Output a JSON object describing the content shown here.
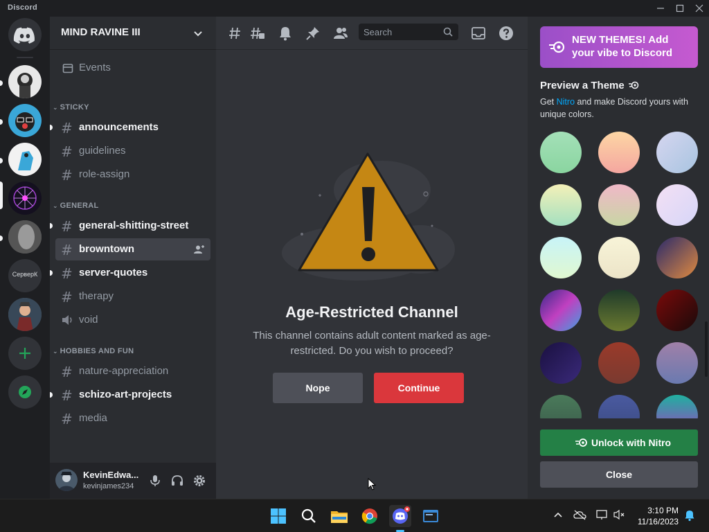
{
  "window": {
    "title": "Discord"
  },
  "guild": {
    "name": "MIND RAVINE III"
  },
  "sidebar": {
    "events_label": "Events",
    "categories": [
      {
        "name": "STICKY",
        "channels": [
          {
            "label": "announcements",
            "unread": true,
            "kind": "announcement"
          },
          {
            "label": "guidelines",
            "unread": false,
            "kind": "text"
          },
          {
            "label": "role-assign",
            "unread": false,
            "kind": "text"
          }
        ]
      },
      {
        "name": "GENERAL",
        "channels": [
          {
            "label": "general-shitting-street",
            "unread": true,
            "kind": "text"
          },
          {
            "label": "browntown",
            "active": true,
            "kind": "text"
          },
          {
            "label": "server-quotes",
            "unread": true,
            "kind": "text"
          },
          {
            "label": "therapy",
            "unread": false,
            "kind": "text"
          },
          {
            "label": "void",
            "unread": false,
            "kind": "voice"
          }
        ]
      },
      {
        "name": "HOBBIES AND FUN",
        "channels": [
          {
            "label": "nature-appreciation",
            "unread": false,
            "kind": "text"
          },
          {
            "label": "schizo-art-projects",
            "unread": true,
            "kind": "text"
          },
          {
            "label": "media",
            "unread": false,
            "kind": "text"
          }
        ]
      }
    ]
  },
  "servers": {
    "text_server_label": "СерверК"
  },
  "user": {
    "display_name": "KevinEdwa...",
    "username": "kevinjames234"
  },
  "toolbar": {
    "search_placeholder": "Search"
  },
  "age_gate": {
    "title": "Age-Restricted Channel",
    "description": "This channel contains adult content marked as age-restricted. Do you wish to proceed?",
    "nope_label": "Nope",
    "continue_label": "Continue"
  },
  "theme_panel": {
    "promo_text": "NEW THEMES! Add your vibe to Discord",
    "title": "Preview a Theme",
    "desc_prefix": "Get ",
    "desc_link": "Nitro",
    "desc_suffix": " and make Discord yours with unique colors.",
    "unlock_label": "Unlock with Nitro",
    "close_label": "Close",
    "swatches": [
      "linear-gradient(180deg,#a4e0b8,#8ad5a0)",
      "linear-gradient(180deg,#fdd6a4,#f4a6a0)",
      "linear-gradient(135deg,#d6d6f0,#a8c4e0)",
      "linear-gradient(180deg,#f4f0b8,#a4e0c0)",
      "linear-gradient(180deg,#f0b8c8,#c8d6a4)",
      "linear-gradient(135deg,#f4e0f4,#d6d6f8)",
      "linear-gradient(180deg,#c8f4f8,#e0f8d0)",
      "linear-gradient(180deg,#f8f4d8,#ece4c8)",
      "linear-gradient(135deg,#2a2a6a,#e08a40)",
      "linear-gradient(135deg,#3a2a8a,#c040c0,#40a0e0)",
      "linear-gradient(180deg,#1f3a2a,#6a7a30)",
      "linear-gradient(135deg,#7a0a0a,#1a0a0a)",
      "linear-gradient(135deg,#1a1040,#3a2a7a)",
      "linear-gradient(180deg,#9a3a2a,#7a3a30)",
      "linear-gradient(180deg,#a080a8,#6a7ab0)",
      "linear-gradient(180deg,#4a7a5a,#3a5a4a)",
      "linear-gradient(180deg,#4a5aa0,#3a4a80)",
      "linear-gradient(180deg,#20b0a0,#a040c0)"
    ]
  },
  "taskbar": {
    "time": "3:10 PM",
    "date": "11/16/2023"
  },
  "colors": {
    "blurple": "#5865f2",
    "danger": "#da373c",
    "green": "#248046",
    "nitro_link": "#00a8fc"
  }
}
